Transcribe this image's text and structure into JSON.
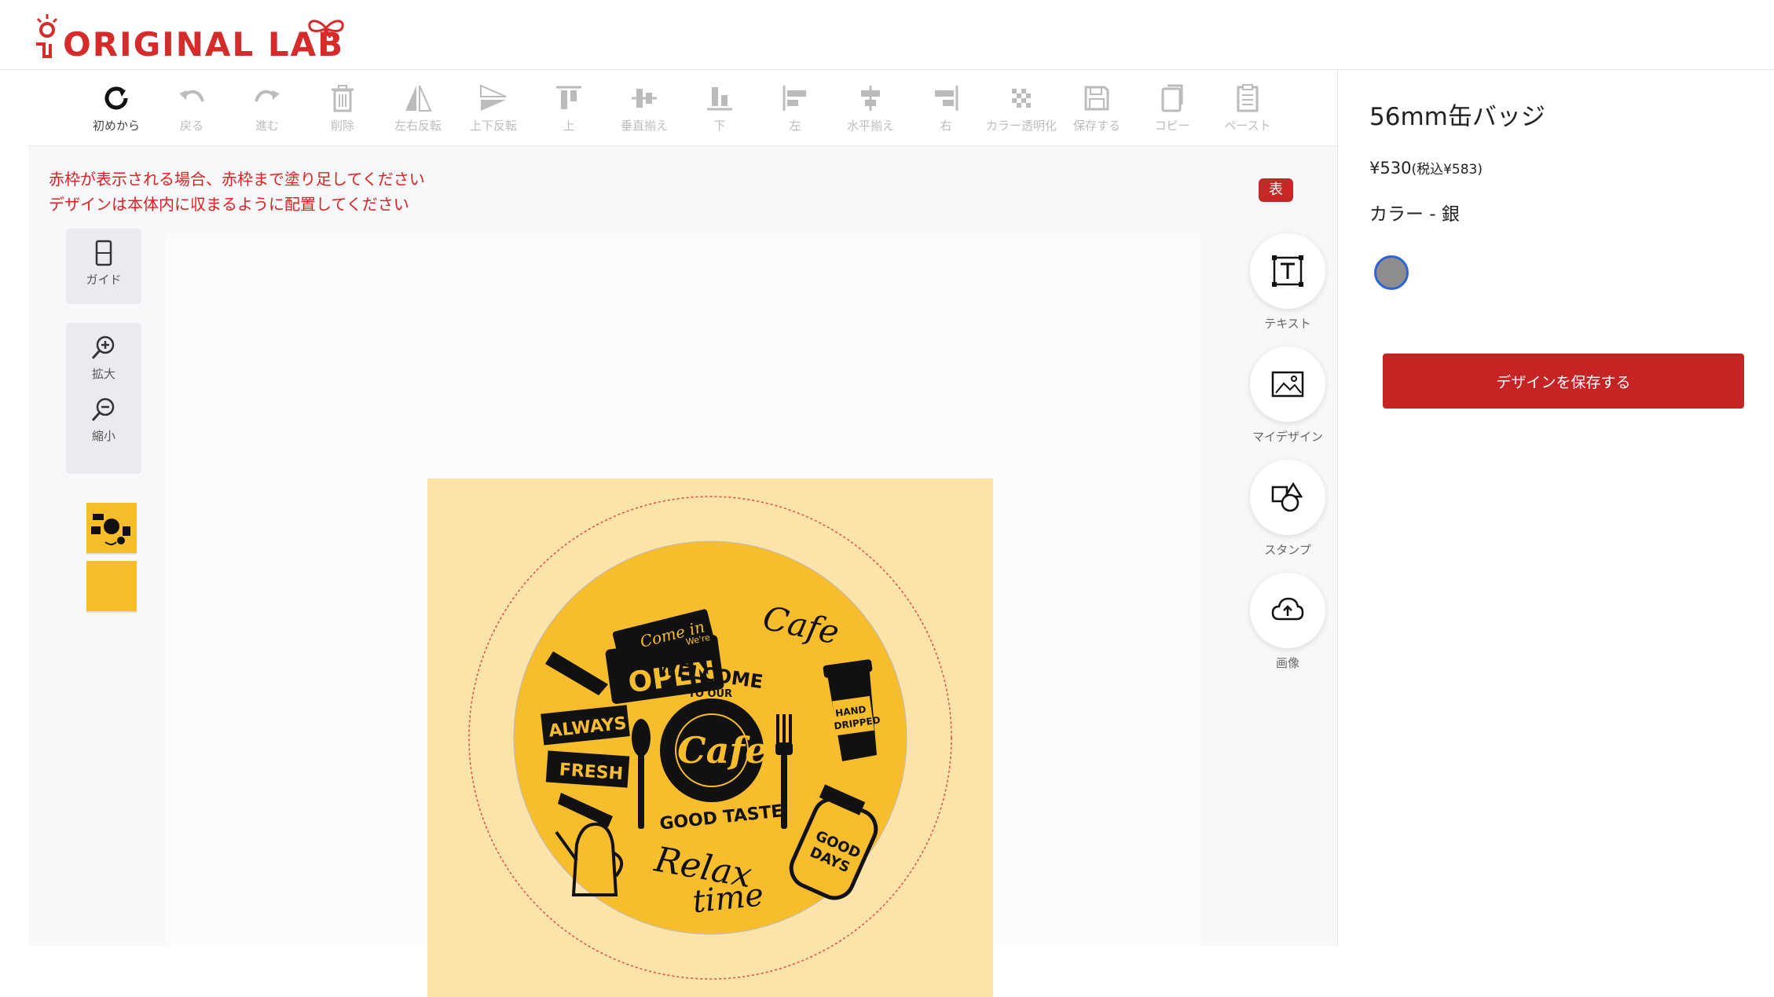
{
  "header": {
    "logo_text": "ORIGINAL LAB"
  },
  "toolbar": {
    "tools": [
      {
        "label": "初めから",
        "icon": "reset-icon"
      },
      {
        "label": "戻る",
        "icon": "undo-icon"
      },
      {
        "label": "進む",
        "icon": "redo-icon"
      },
      {
        "label": "削除",
        "icon": "trash-icon"
      },
      {
        "label": "左右反転",
        "icon": "flip-horizontal-icon"
      },
      {
        "label": "上下反転",
        "icon": "flip-vertical-icon"
      },
      {
        "label": "上",
        "icon": "align-top-icon"
      },
      {
        "label": "垂直揃え",
        "icon": "align-vertical-center-icon"
      },
      {
        "label": "下",
        "icon": "align-bottom-icon"
      },
      {
        "label": "左",
        "icon": "align-left-icon"
      },
      {
        "label": "水平揃え",
        "icon": "align-horizontal-center-icon"
      },
      {
        "label": "右",
        "icon": "align-right-icon"
      },
      {
        "label": "カラー透明化",
        "icon": "transparency-icon"
      },
      {
        "label": "保存する",
        "icon": "save-icon"
      },
      {
        "label": "コピー",
        "icon": "copy-icon"
      },
      {
        "label": "ペースト",
        "icon": "paste-icon"
      }
    ]
  },
  "editor": {
    "warning_line1": "赤枠が表示される場合、赤枠まで塗り足してください",
    "warning_line2": "デザインは本体内に収まるように配置してください",
    "side_badge": "表",
    "left_tools": {
      "guide": "ガイド",
      "zoom_in": "拡大",
      "zoom_out": "縮小"
    },
    "right_tools": {
      "text": "テキスト",
      "my_design": "マイデザイン",
      "stamp": "スタンプ",
      "image": "画像"
    },
    "artwork": {
      "sign_top": "Come in",
      "sign_small": "We're",
      "sign_main": "OPEN",
      "cafe_script": "Cafe",
      "welcome": "WELCOME",
      "to_our": "TO OUR",
      "center_cafe": "Cafe",
      "good_taste": "GOOD TASTE",
      "always": "ALWAYS",
      "fresh": "FRESH",
      "hand": "HAND",
      "dripped": "DRIPPED",
      "good": "GOOD",
      "days": "DAYS",
      "relax": "Relax",
      "time": "time"
    }
  },
  "product": {
    "title": "56mm缶バッジ",
    "price": "¥530",
    "price_tax": "(税込¥583)",
    "color_label": "カラー - 銀",
    "save_button": "デザインを保存する"
  },
  "colors": {
    "accent": "#c62424",
    "badge_yellow": "#f8bd2c",
    "bleed": "#fbe3a9",
    "swatch_silver": "#8d8d8d"
  }
}
